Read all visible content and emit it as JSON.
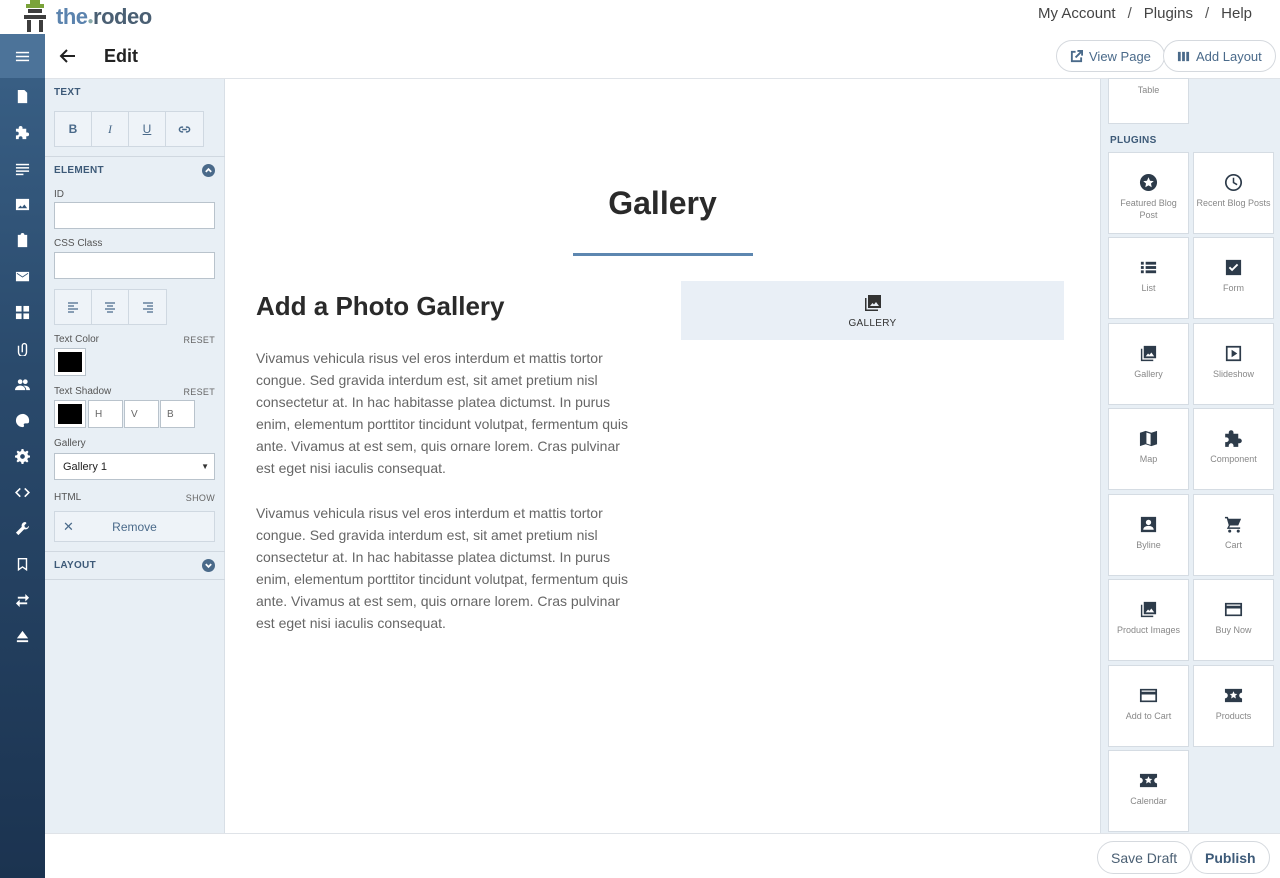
{
  "brand": {
    "the": "the",
    "name": "rodeo"
  },
  "topnav": {
    "account": "My Account",
    "plugins": "Plugins",
    "help": "Help",
    "sep": "/"
  },
  "editor": {
    "title": "Edit",
    "view_page": "View Page",
    "add_layout": "Add Layout"
  },
  "left_panel": {
    "text_heading": "TEXT",
    "format_buttons": [
      "B",
      "I",
      "U"
    ],
    "element_heading": "ELEMENT",
    "id_label": "ID",
    "css_label": "CSS Class",
    "text_color_label": "Text Color",
    "reset": "RESET",
    "text_shadow_label": "Text Shadow",
    "shadow_h": "H",
    "shadow_v": "V",
    "shadow_b": "B",
    "gallery_label": "Gallery",
    "gallery_value": "Gallery 1",
    "html_label": "HTML",
    "show": "SHOW",
    "remove": "Remove",
    "layout_heading": "LAYOUT"
  },
  "canvas": {
    "title": "Gallery",
    "heading": "Add a Photo Gallery",
    "para1": "Vivamus vehicula risus vel eros interdum et mattis tortor congue. Sed gravida interdum est, sit amet pretium nisl consectetur at. In hac habitasse platea dictumst. In purus enim, elementum porttitor tincidunt volutpat, fermentum quis ante. Vivamus at est sem, quis ornare lorem. Cras pulvinar est eget nisi iaculis consequat.",
    "para2": "Vivamus vehicula risus vel eros interdum et mattis tortor congue. Sed gravida interdum est, sit amet pretium nisl consectetur at. In hac habitasse platea dictumst. In purus enim, elementum porttitor tincidunt volutpat, fermentum quis ante. Vivamus at est sem, quis ornare lorem. Cras pulvinar est eget nisi iaculis consequat.",
    "gallery_block_label": "GALLERY"
  },
  "right_panel": {
    "table": "Table",
    "plugins_heading": "PLUGINS",
    "tiles": [
      "Featured Blog Post",
      "Recent Blog Posts",
      "List",
      "Form",
      "Gallery",
      "Slideshow",
      "Map",
      "Component",
      "Byline",
      "Cart",
      "Product Images",
      "Buy Now",
      "Add to Cart",
      "Products",
      "Calendar"
    ]
  },
  "footer": {
    "save_draft": "Save Draft",
    "publish": "Publish"
  }
}
